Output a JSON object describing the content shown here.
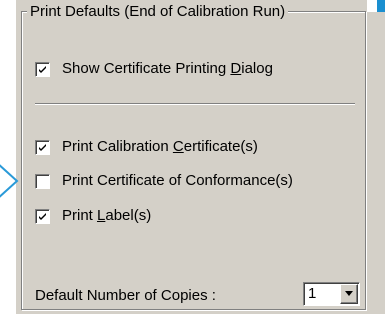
{
  "group": {
    "title": "Print Defaults (End of Calibration Run)"
  },
  "options": [
    {
      "label_pre": "Show Certificate Printing ",
      "label_accel": "D",
      "label_post": "ialog",
      "checked": true
    },
    {
      "label_pre": "Print Calibration ",
      "label_accel": "C",
      "label_post": "ertificate(s)",
      "checked": true
    },
    {
      "label_pre": "Print Certificate of Conformance(s)",
      "label_accel": "",
      "label_post": "",
      "checked": false
    },
    {
      "label_pre": "Print ",
      "label_accel": "L",
      "label_post": "abel(s)",
      "checked": true
    }
  ],
  "copies": {
    "label": "Default Number of Copies :",
    "value": "1"
  },
  "icons": {
    "check": "check-icon",
    "dropdown": "chevron-down-icon",
    "pointer": "arrow-right-icon"
  },
  "colors": {
    "panel": "#d4d0c8",
    "accent_blue": "#1a8fd0"
  }
}
